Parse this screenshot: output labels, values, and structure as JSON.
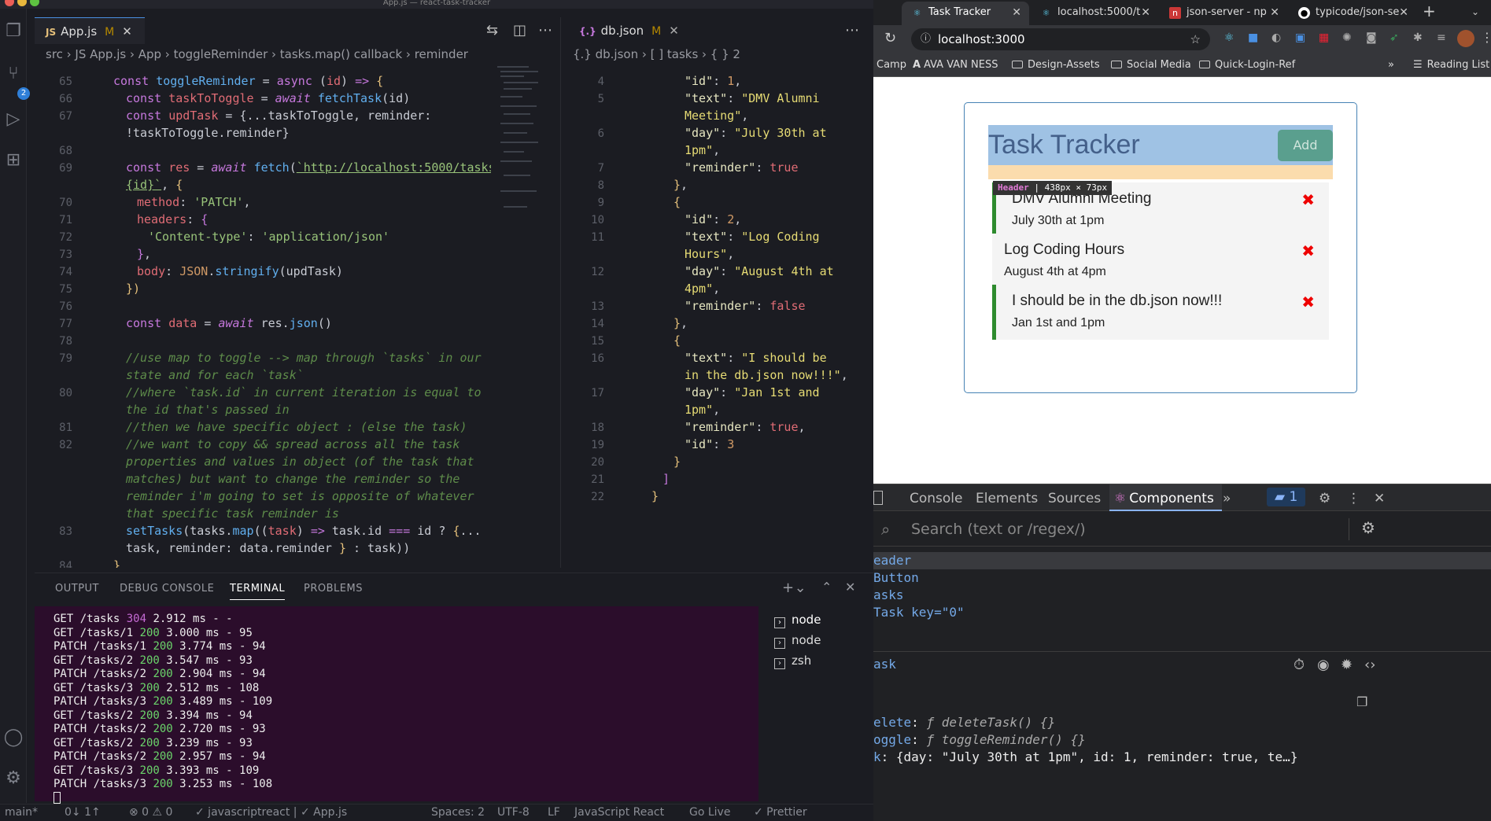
{
  "vscode": {
    "window_title": "App.js — react-task-tracker",
    "tabs": [
      {
        "icon": "JS",
        "label": "App.js",
        "status": "M"
      },
      {
        "icon": "{.}",
        "label": "db.json",
        "status": "M"
      }
    ],
    "breadcrumbs_left": "src  ›  JS App.js  ›  App  ›  toggleReminder  ›  tasks.map() callback  ›  reminder",
    "breadcrumbs_right": "{.} db.json  ›  [ ] tasks  ›  { } 2",
    "scm_badge": "2",
    "panel": {
      "tabs": [
        "OUTPUT",
        "DEBUG CONSOLE",
        "TERMINAL",
        "PROBLEMS"
      ],
      "terminal_lines": [
        {
          "method": "GET",
          "path": "/tasks",
          "code": "304",
          "rest": "2.912 ms - -"
        },
        {
          "method": "GET",
          "path": "/tasks/1",
          "code": "200",
          "rest": "3.000 ms - 95"
        },
        {
          "method": "PATCH",
          "path": "/tasks/1",
          "code": "200",
          "rest": "3.774 ms - 94"
        },
        {
          "method": "GET",
          "path": "/tasks/2",
          "code": "200",
          "rest": "3.547 ms - 93"
        },
        {
          "method": "PATCH",
          "path": "/tasks/2",
          "code": "200",
          "rest": "2.904 ms - 94"
        },
        {
          "method": "GET",
          "path": "/tasks/3",
          "code": "200",
          "rest": "2.512 ms - 108"
        },
        {
          "method": "PATCH",
          "path": "/tasks/3",
          "code": "200",
          "rest": "3.489 ms - 109"
        },
        {
          "method": "GET",
          "path": "/tasks/2",
          "code": "200",
          "rest": "3.394 ms - 94"
        },
        {
          "method": "PATCH",
          "path": "/tasks/2",
          "code": "200",
          "rest": "2.720 ms - 93"
        },
        {
          "method": "GET",
          "path": "/tasks/2",
          "code": "200",
          "rest": "3.239 ms - 93"
        },
        {
          "method": "PATCH",
          "path": "/tasks/2",
          "code": "200",
          "rest": "2.957 ms - 94"
        },
        {
          "method": "GET",
          "path": "/tasks/3",
          "code": "200",
          "rest": "3.393 ms - 109"
        },
        {
          "method": "PATCH",
          "path": "/tasks/3",
          "code": "200",
          "rest": "3.253 ms - 108"
        }
      ],
      "terminals": [
        "node",
        "node",
        "zsh"
      ]
    },
    "statusbar": {
      "branch": "main*",
      "sync": "0↓ 1↑",
      "problems": "⊗ 0  ⚠ 0",
      "language_check": "✓ javascriptreact | ✓ App.js",
      "spaces": "Spaces: 2",
      "encoding": "UTF-8",
      "eol": "LF",
      "language": "JavaScript React",
      "golive": "Go Live",
      "prettier": "✓ Prettier"
    }
  },
  "browser": {
    "tabs": [
      {
        "label": "Task Tracker",
        "active": true
      },
      {
        "label": "localhost:5000/t",
        "active": false
      },
      {
        "label": "json-server - np",
        "active": false
      },
      {
        "label": "typicode/json-se",
        "active": false
      }
    ],
    "url": "localhost:3000",
    "bookmarks": [
      "Camp",
      "AVA VAN NESS",
      "Design-Assets",
      "Social Media",
      "Quick-Login-Ref",
      "Reading List"
    ],
    "app": {
      "title": "Task Tracker",
      "add_button": "Add",
      "inspect_label_name": "Header",
      "inspect_label_size": "438px × 73px",
      "tasks": [
        {
          "text": "DMV Alumni Meeting",
          "day": "July 30th at 1pm",
          "reminder": true
        },
        {
          "text": "Log Coding Hours",
          "day": "August 4th at 4pm",
          "reminder": false
        },
        {
          "text": "I should be in the db.json now!!!",
          "day": "Jan 1st and 1pm",
          "reminder": true
        }
      ],
      "delete_glyph": "✖"
    },
    "devtools": {
      "tabs": [
        "Console",
        "Elements",
        "Sources",
        "Components"
      ],
      "active_tab": "Components",
      "issues_count": "1",
      "search_placeholder": "Search (text or /regex/)",
      "tree": [
        "eader",
        "Button",
        "asks",
        "Task key=\"0\""
      ],
      "selected_component": "ask",
      "props": [
        {
          "key": "elete",
          "value": "ƒ deleteTask() {}"
        },
        {
          "key": "oggle",
          "value": "ƒ toggleReminder() {}"
        },
        {
          "key": "k",
          "value": "{day: \"July 30th at 1pm\", id: 1, reminder: true, te…}"
        }
      ]
    }
  }
}
